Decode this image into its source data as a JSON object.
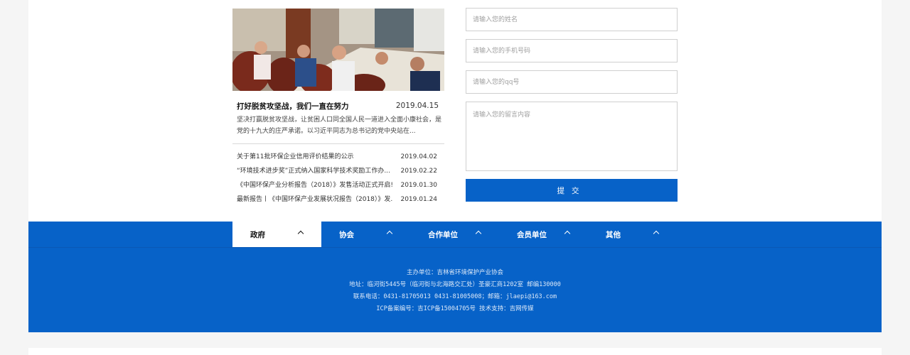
{
  "news": {
    "featured": {
      "title": "打好脱贫攻坚战，我们一直在努力",
      "date": "2019.04.15",
      "summary": "坚决打赢脱贫攻坚战，让贫困人口同全国人民一道进入全面小康社会，是党的十九大的庄严承诺。以习近平同志为总书记的党中央站在..."
    },
    "items": [
      {
        "title": "关于第11批环保企业信用评价结果的公示",
        "date": "2019.04.02"
      },
      {
        "title": "“环境技术进步奖”正式纳入国家科学技术奖励工作办...",
        "date": "2019.02.22"
      },
      {
        "title": "《中国环保产业分析报告（2018）》发售活动正式开启!",
        "date": "2019.01.30"
      },
      {
        "title": "最新报告丨《中国环保产业发展状况报告（2018）》发...",
        "date": "2019.01.24"
      }
    ]
  },
  "form": {
    "name_placeholder": "请输入您的姓名",
    "phone_placeholder": "请输入您的手机号码",
    "qq_placeholder": "请输入您的qq号",
    "message_placeholder": "请输入您的留言内容",
    "submit_label": "提交"
  },
  "footer": {
    "tabs": [
      {
        "label": "政府"
      },
      {
        "label": "协会"
      },
      {
        "label": "合作单位"
      },
      {
        "label": "会员单位"
      },
      {
        "label": "其他"
      }
    ],
    "host": "主办单位：吉林省环境保护产业协会",
    "address": "地址：临河街5445号（临河街与北海路交汇处）圣豪汇商1202室   邮编130000",
    "contact": "联系电话：0431-81705013  0431-81005008；邮箱：jlaepi@163.com",
    "icp": "ICP备案编号：吉ICP备15004705号   技术支持：吉网传媒"
  },
  "colors": {
    "brand_blue": "#0762c8"
  }
}
